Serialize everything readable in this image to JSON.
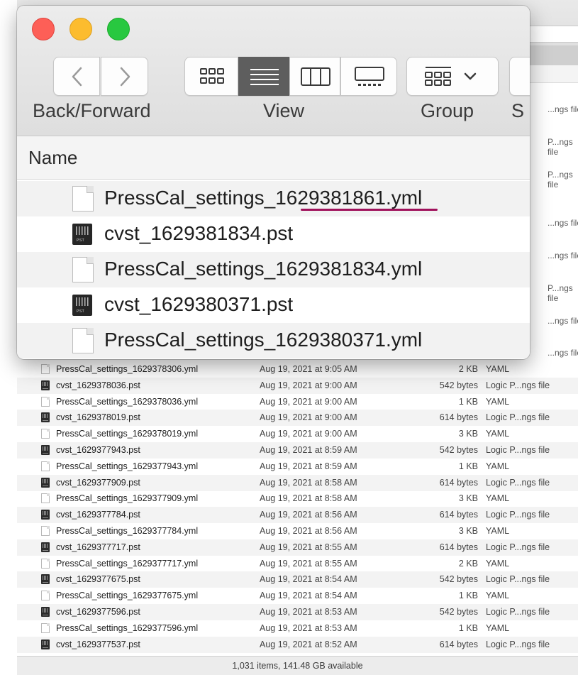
{
  "window": {
    "toolbar": {
      "back_forward_label": "Back/Forward",
      "view_label": "View",
      "group_label": "Group",
      "share_label_fragment": "S"
    },
    "column_header": {
      "name_label": "Name"
    }
  },
  "zoom_files": [
    {
      "name": "PressCal_settings_1629381861.yml",
      "type": "yml"
    },
    {
      "name": "cvst_1629381834.pst",
      "type": "pst"
    },
    {
      "name": "PressCal_settings_1629381834.yml",
      "type": "yml"
    },
    {
      "name": "cvst_1629380371.pst",
      "type": "pst"
    },
    {
      "name": "PressCal_settings_1629380371.yml",
      "type": "yml"
    }
  ],
  "background_kind_fragments": [
    "...ngs file",
    "P...ngs file",
    "P...ngs file",
    "...ngs file",
    "...ngs file",
    "P...ngs file",
    "...ngs file",
    "...ngs file"
  ],
  "files": [
    {
      "name": "PressCal_settings_1629378306.yml",
      "date": "Aug 19, 2021 at 9:05 AM",
      "size": "2 KB",
      "kind": "YAML",
      "type": "yml"
    },
    {
      "name": "cvst_1629378036.pst",
      "date": "Aug 19, 2021 at 9:00 AM",
      "size": "542 bytes",
      "kind": "Logic P...ngs file",
      "type": "pst"
    },
    {
      "name": "PressCal_settings_1629378036.yml",
      "date": "Aug 19, 2021 at 9:00 AM",
      "size": "1 KB",
      "kind": "YAML",
      "type": "yml"
    },
    {
      "name": "cvst_1629378019.pst",
      "date": "Aug 19, 2021 at 9:00 AM",
      "size": "614 bytes",
      "kind": "Logic P...ngs file",
      "type": "pst"
    },
    {
      "name": "PressCal_settings_1629378019.yml",
      "date": "Aug 19, 2021 at 9:00 AM",
      "size": "3 KB",
      "kind": "YAML",
      "type": "yml"
    },
    {
      "name": "cvst_1629377943.pst",
      "date": "Aug 19, 2021 at 8:59 AM",
      "size": "542 bytes",
      "kind": "Logic P...ngs file",
      "type": "pst"
    },
    {
      "name": "PressCal_settings_1629377943.yml",
      "date": "Aug 19, 2021 at 8:59 AM",
      "size": "1 KB",
      "kind": "YAML",
      "type": "yml"
    },
    {
      "name": "cvst_1629377909.pst",
      "date": "Aug 19, 2021 at 8:58 AM",
      "size": "614 bytes",
      "kind": "Logic P...ngs file",
      "type": "pst"
    },
    {
      "name": "PressCal_settings_1629377909.yml",
      "date": "Aug 19, 2021 at 8:58 AM",
      "size": "3 KB",
      "kind": "YAML",
      "type": "yml"
    },
    {
      "name": "cvst_1629377784.pst",
      "date": "Aug 19, 2021 at 8:56 AM",
      "size": "614 bytes",
      "kind": "Logic P...ngs file",
      "type": "pst"
    },
    {
      "name": "PressCal_settings_1629377784.yml",
      "date": "Aug 19, 2021 at 8:56 AM",
      "size": "3 KB",
      "kind": "YAML",
      "type": "yml"
    },
    {
      "name": "cvst_1629377717.pst",
      "date": "Aug 19, 2021 at 8:55 AM",
      "size": "614 bytes",
      "kind": "Logic P...ngs file",
      "type": "pst"
    },
    {
      "name": "PressCal_settings_1629377717.yml",
      "date": "Aug 19, 2021 at 8:55 AM",
      "size": "2 KB",
      "kind": "YAML",
      "type": "yml"
    },
    {
      "name": "cvst_1629377675.pst",
      "date": "Aug 19, 2021 at 8:54 AM",
      "size": "542 bytes",
      "kind": "Logic P...ngs file",
      "type": "pst"
    },
    {
      "name": "PressCal_settings_1629377675.yml",
      "date": "Aug 19, 2021 at 8:54 AM",
      "size": "1 KB",
      "kind": "YAML",
      "type": "yml"
    },
    {
      "name": "cvst_1629377596.pst",
      "date": "Aug 19, 2021 at 8:53 AM",
      "size": "542 bytes",
      "kind": "Logic P...ngs file",
      "type": "pst"
    },
    {
      "name": "PressCal_settings_1629377596.yml",
      "date": "Aug 19, 2021 at 8:53 AM",
      "size": "1 KB",
      "kind": "YAML",
      "type": "yml"
    },
    {
      "name": "cvst_1629377537.pst",
      "date": "Aug 19, 2021 at 8:52 AM",
      "size": "614 bytes",
      "kind": "Logic P...ngs file",
      "type": "pst"
    }
  ],
  "status_bar": {
    "text": "1,031 items, 141.48 GB available"
  },
  "colors": {
    "highlight_underline": "#a0115b",
    "close": "#fd5f57",
    "minimize": "#fcbc2e",
    "maximize": "#28c840",
    "selected_view": "#5e5e5e"
  }
}
